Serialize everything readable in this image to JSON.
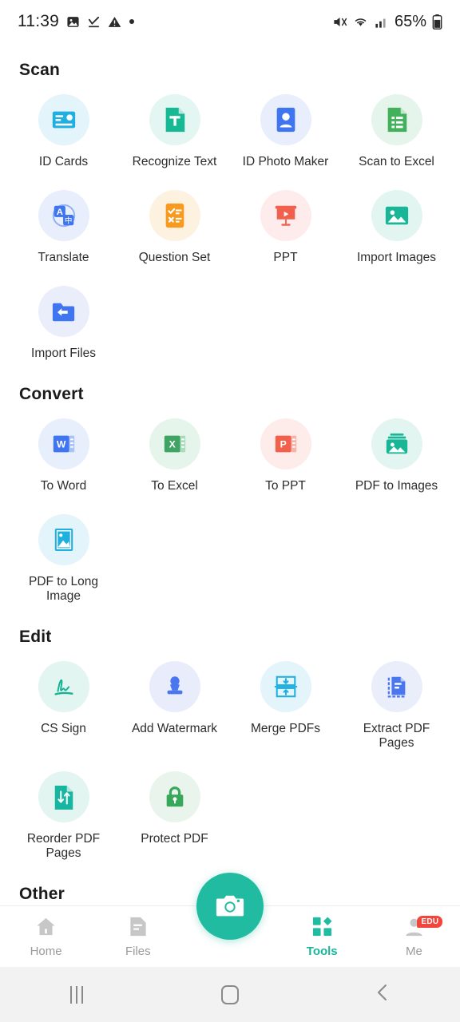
{
  "statusbar": {
    "time": "11:39",
    "left_icons": [
      "image-icon",
      "download-complete-icon",
      "warning-icon",
      "dot-icon"
    ],
    "right_icons": [
      "mute-icon",
      "wifi-icon",
      "signal-icon"
    ],
    "battery": "65%"
  },
  "sections": [
    {
      "title": "Scan",
      "items": [
        {
          "label": "ID Cards",
          "icon": "id-card-icon",
          "bubble": "#e4f4fb",
          "color": "#1fb0df"
        },
        {
          "label": "Recognize Text",
          "icon": "text-document-icon",
          "bubble": "#e4f6f1",
          "color": "#17b894"
        },
        {
          "label": "ID Photo Maker",
          "icon": "id-photo-icon",
          "bubble": "#e8eefc",
          "color": "#3f76ef"
        },
        {
          "label": "Scan to Excel",
          "icon": "excel-list-icon",
          "bubble": "#e6f5ec",
          "color": "#43b05c"
        },
        {
          "label": "Translate",
          "icon": "translate-icon",
          "bubble": "#e8eefc",
          "color": "#3f76ef"
        },
        {
          "label": "Question Set",
          "icon": "question-set-icon",
          "bubble": "#fdf1e0",
          "color": "#f79a1e"
        },
        {
          "label": "PPT",
          "icon": "presentation-icon",
          "bubble": "#fdeceb",
          "color": "#f0604d"
        },
        {
          "label": "Import Images",
          "icon": "image-import-icon",
          "bubble": "#e2f5f0",
          "color": "#18b596"
        },
        {
          "label": "Import Files",
          "icon": "folder-import-icon",
          "bubble": "#eaeefb",
          "color": "#3f76ef"
        }
      ]
    },
    {
      "title": "Convert",
      "items": [
        {
          "label": "To Word",
          "icon": "word-icon",
          "bubble": "#e7eefc",
          "color": "#3f76ef"
        },
        {
          "label": "To Excel",
          "icon": "excel-icon",
          "bubble": "#e6f5ec",
          "color": "#3fa463"
        },
        {
          "label": "To PPT",
          "icon": "powerpoint-icon",
          "bubble": "#fdecea",
          "color": "#f0604d"
        },
        {
          "label": "PDF to Images",
          "icon": "pdf-to-images-icon",
          "bubble": "#e2f5f0",
          "color": "#18b596"
        },
        {
          "label": "PDF to Long Image",
          "icon": "long-image-icon",
          "bubble": "#e4f4fb",
          "color": "#1fb0df"
        }
      ]
    },
    {
      "title": "Edit",
      "items": [
        {
          "label": "CS Sign",
          "icon": "signature-icon",
          "bubble": "#e2f5f0",
          "color": "#16b394"
        },
        {
          "label": "Add Watermark",
          "icon": "stamp-icon",
          "bubble": "#e9edfb",
          "color": "#4a77ef"
        },
        {
          "label": "Merge PDFs",
          "icon": "merge-icon",
          "bubble": "#e4f4fb",
          "color": "#1fb0df"
        },
        {
          "label": "Extract PDF Pages",
          "icon": "extract-pages-icon",
          "bubble": "#eaeefb",
          "color": "#4a77ef"
        },
        {
          "label": "Reorder PDF Pages",
          "icon": "reorder-pages-icon",
          "bubble": "#e2f5f0",
          "color": "#16b6a0"
        },
        {
          "label": "Protect PDF",
          "icon": "lock-icon",
          "bubble": "#e9f5ec",
          "color": "#37a85a"
        }
      ]
    },
    {
      "title": "Other",
      "items": []
    }
  ],
  "bottom_nav": {
    "items": [
      {
        "label": "Home",
        "icon": "home-icon",
        "active": false
      },
      {
        "label": "Files",
        "icon": "files-icon",
        "active": false
      },
      {
        "label": "Tools",
        "icon": "tools-icon",
        "active": true
      },
      {
        "label": "Me",
        "icon": "profile-icon",
        "active": false,
        "badge": "EDU"
      }
    ],
    "camera_button": "camera-icon",
    "accent": "#20bba0"
  },
  "system_nav": {
    "recents": "recents-icon",
    "home": "home-square-icon",
    "back": "back-chevron-icon"
  }
}
